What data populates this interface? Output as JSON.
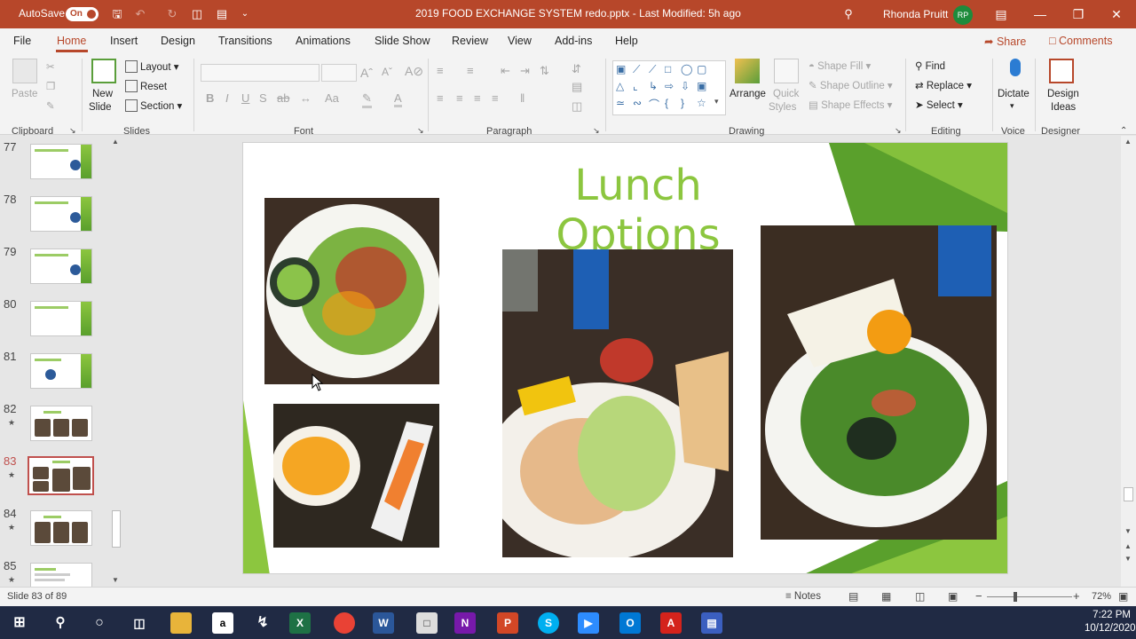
{
  "titlebar": {
    "autosave_label": "AutoSave",
    "autosave_state": "On",
    "doc_title": "2019 FOOD EXCHANGE SYSTEM redo.pptx  -  Last Modified: 5h ago",
    "user_name": "Rhonda Pruitt",
    "user_initials": "RP"
  },
  "tabs": [
    "File",
    "Home",
    "Insert",
    "Design",
    "Transitions",
    "Animations",
    "Slide Show",
    "Review",
    "View",
    "Add-ins",
    "Help"
  ],
  "share_label": "Share",
  "comments_label": "Comments",
  "ribbon": {
    "clipboard": {
      "paste": "Paste",
      "label": "Clipboard"
    },
    "slides": {
      "new_slide": "New",
      "new_slide2": "Slide",
      "layout": "Layout",
      "reset": "Reset",
      "section": "Section",
      "label": "Slides"
    },
    "font": {
      "label": "Font",
      "bold": "B",
      "italic": "I",
      "underline": "U",
      "strike": "S",
      "shadow": "ab",
      "case": "Aa"
    },
    "paragraph": {
      "label": "Paragraph"
    },
    "drawing": {
      "arrange": "Arrange",
      "quick_styles": "Quick",
      "quick_styles2": "Styles",
      "shape_fill": "Shape Fill",
      "shape_outline": "Shape Outline",
      "shape_effects": "Shape Effects",
      "label": "Drawing"
    },
    "editing": {
      "find": "Find",
      "replace": "Replace",
      "select": "Select",
      "label": "Editing"
    },
    "voice": {
      "dictate": "Dictate",
      "label": "Voice"
    },
    "designer": {
      "design_ideas": "Design",
      "design_ideas2": "Ideas",
      "label": "Designer"
    }
  },
  "thumbnails": [
    {
      "num": "77",
      "star": false
    },
    {
      "num": "78",
      "star": false
    },
    {
      "num": "79",
      "star": false
    },
    {
      "num": "80",
      "star": false
    },
    {
      "num": "81",
      "star": false
    },
    {
      "num": "82",
      "star": true
    },
    {
      "num": "83",
      "star": true,
      "selected": true
    },
    {
      "num": "84",
      "star": true
    },
    {
      "num": "85",
      "star": true
    }
  ],
  "slide": {
    "title": "Lunch Options"
  },
  "statusbar": {
    "slide_count": "Slide 83 of 89",
    "notes": "Notes",
    "zoom": "72%"
  },
  "taskbar": {
    "time": "7:22 PM",
    "date": "10/12/2020"
  },
  "colors": {
    "accent": "#b7472a",
    "title_green": "#8cc63f"
  }
}
